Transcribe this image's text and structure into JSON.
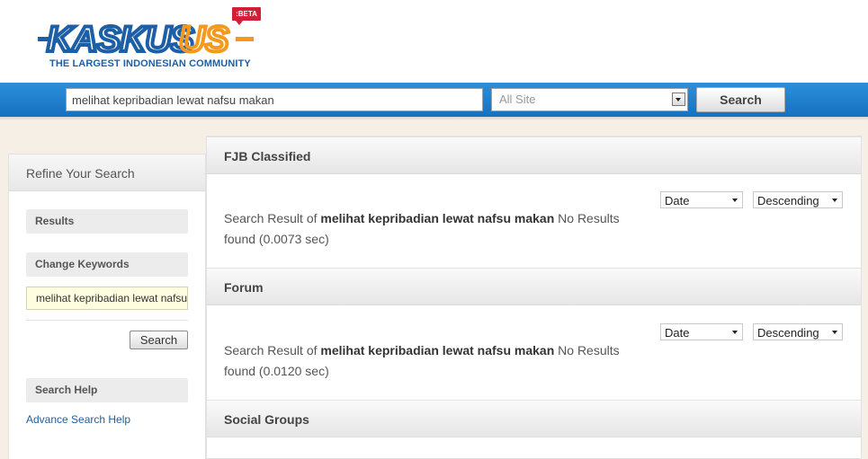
{
  "header": {
    "logo_word": "KASKUS",
    "logo_tagline": "THE LARGEST INDONESIAN COMMUNITY",
    "beta_badge": ":BETA",
    "colors": {
      "brand_blue": "#1d5fa6",
      "brand_orange": "#f39a1e",
      "badge_red": "#d11f35"
    }
  },
  "searchbar": {
    "query_value": "melihat kepribadian lewat nafsu makan",
    "scope_selected": "All Site",
    "search_label": "Search",
    "color": "#1e7cc9"
  },
  "sidebar": {
    "title": "Refine Your Search",
    "results_label": "Results",
    "change_keywords_label": "Change Keywords",
    "keyword_value": "melihat kepribadian lewat nafsu makan",
    "search_button": "Search",
    "search_help_label": "Search Help",
    "advance_link": "Advance Search Help"
  },
  "sections": [
    {
      "title": "FJB Classified",
      "sort_by": "Date",
      "sort_order": "Descending",
      "result_prefix": "Search Result of ",
      "result_query": "melihat kepribadian lewat nafsu makan",
      "result_suffix": " No Results found (0.0073 sec)"
    },
    {
      "title": "Forum",
      "sort_by": "Date",
      "sort_order": "Descending",
      "result_prefix": "Search Result of ",
      "result_query": "melihat kepribadian lewat nafsu makan",
      "result_suffix": " No Results found (0.0120 sec)"
    },
    {
      "title": "Social Groups"
    }
  ]
}
